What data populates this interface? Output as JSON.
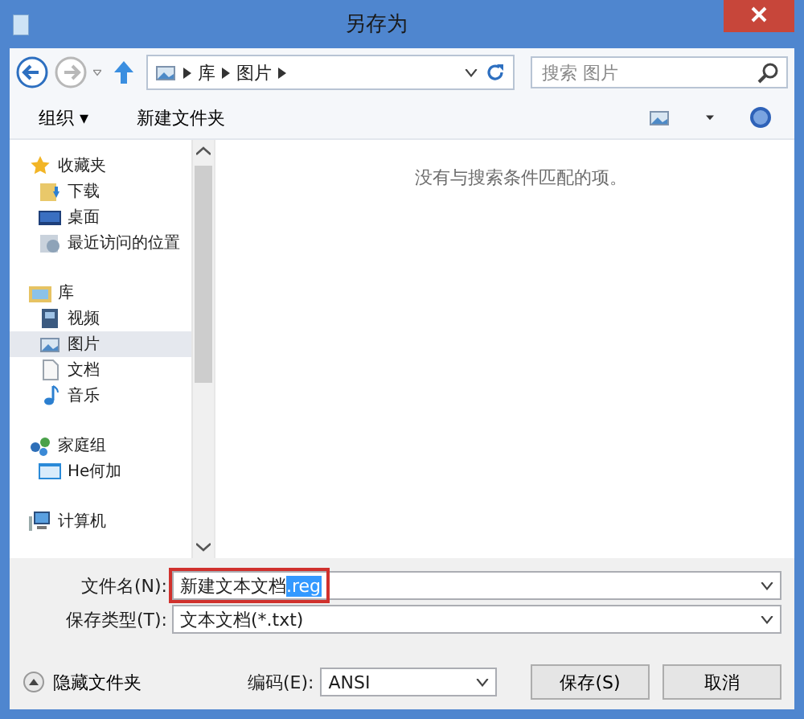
{
  "window": {
    "title": "另存为"
  },
  "nav": {
    "path": [
      "库",
      "图片"
    ],
    "search": {
      "placeholder": "搜索 图片"
    }
  },
  "toolbar": {
    "organize": "组织 ▾",
    "new_folder": "新建文件夹"
  },
  "sidebar": {
    "groups": [
      {
        "label": "收藏夹",
        "children": [
          {
            "label": "下载",
            "selected": false
          },
          {
            "label": "桌面",
            "selected": false
          },
          {
            "label": "最近访问的位置",
            "selected": false
          }
        ]
      },
      {
        "label": "库",
        "children": [
          {
            "label": "视频",
            "selected": false
          },
          {
            "label": "图片",
            "selected": true
          },
          {
            "label": "文档",
            "selected": false
          },
          {
            "label": "音乐",
            "selected": false
          }
        ]
      },
      {
        "label": "家庭组",
        "children": [
          {
            "label": "He何加",
            "selected": false
          }
        ]
      },
      {
        "label": "计算机"
      }
    ]
  },
  "content": {
    "empty_message": "没有与搜索条件匹配的项。"
  },
  "file_name": {
    "label": "文件名(N):",
    "text": "新建文本文档",
    "selected_text": ".reg",
    "highlighted": true
  },
  "save_type": {
    "label": "保存类型(T):",
    "value": "文本文档(*.txt)"
  },
  "hide_folders": "隐藏文件夹",
  "encoding": {
    "label": "编码(E):",
    "value": "ANSI"
  },
  "buttons": [
    "保存(S)",
    "取消"
  ]
}
